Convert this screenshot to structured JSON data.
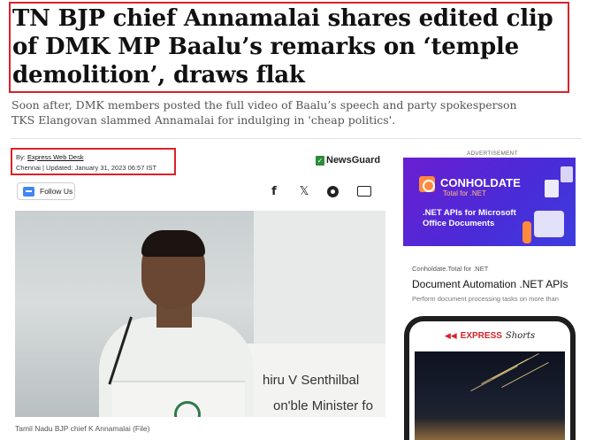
{
  "article": {
    "headline": "TN BJP chief Annamalai shares edited clip of DMK MP Baalu’s remarks on ‘temple demolition’, draws flak",
    "standfirst": "Soon after, DMK members posted the full video of Baalu’s speech and party spokesperson TKS Elangovan slammed Annamalai for indulging in 'cheap politics'.",
    "byline_prefix": "By:",
    "author": "Express Web Desk",
    "dateline": "Chennai | Updated: January 31, 2023 06:57 IST",
    "newsguard_label": "NewsGuard",
    "follow_label": "Follow Us",
    "photo_text_1": "hiru V Senthilbal",
    "photo_text_2": "on'ble Minister fo",
    "caption": "Tamil Nadu BJP chief K Annamalai (File)"
  },
  "share": {
    "facebook_glyph": "f",
    "x_glyph": "𝕏"
  },
  "ad": {
    "label": "ADVERTISEMENT",
    "brand": "CONHOLDATE",
    "tagline": "Total for .NET",
    "line1": ".NET APIs for Microsoft",
    "line2": "Office Documents",
    "source": "Conholdate.Total for .NET",
    "title": "Document Automation .NET APIs",
    "desc": "Perform document processing tasks on more than",
    "colors": {
      "accent": "#ff8a3d",
      "bg": "#4a2bd8"
    }
  },
  "shorts": {
    "brand": "EXPRESS",
    "sub": "Shorts"
  },
  "colors": {
    "highlight_border": "#d9222a"
  }
}
